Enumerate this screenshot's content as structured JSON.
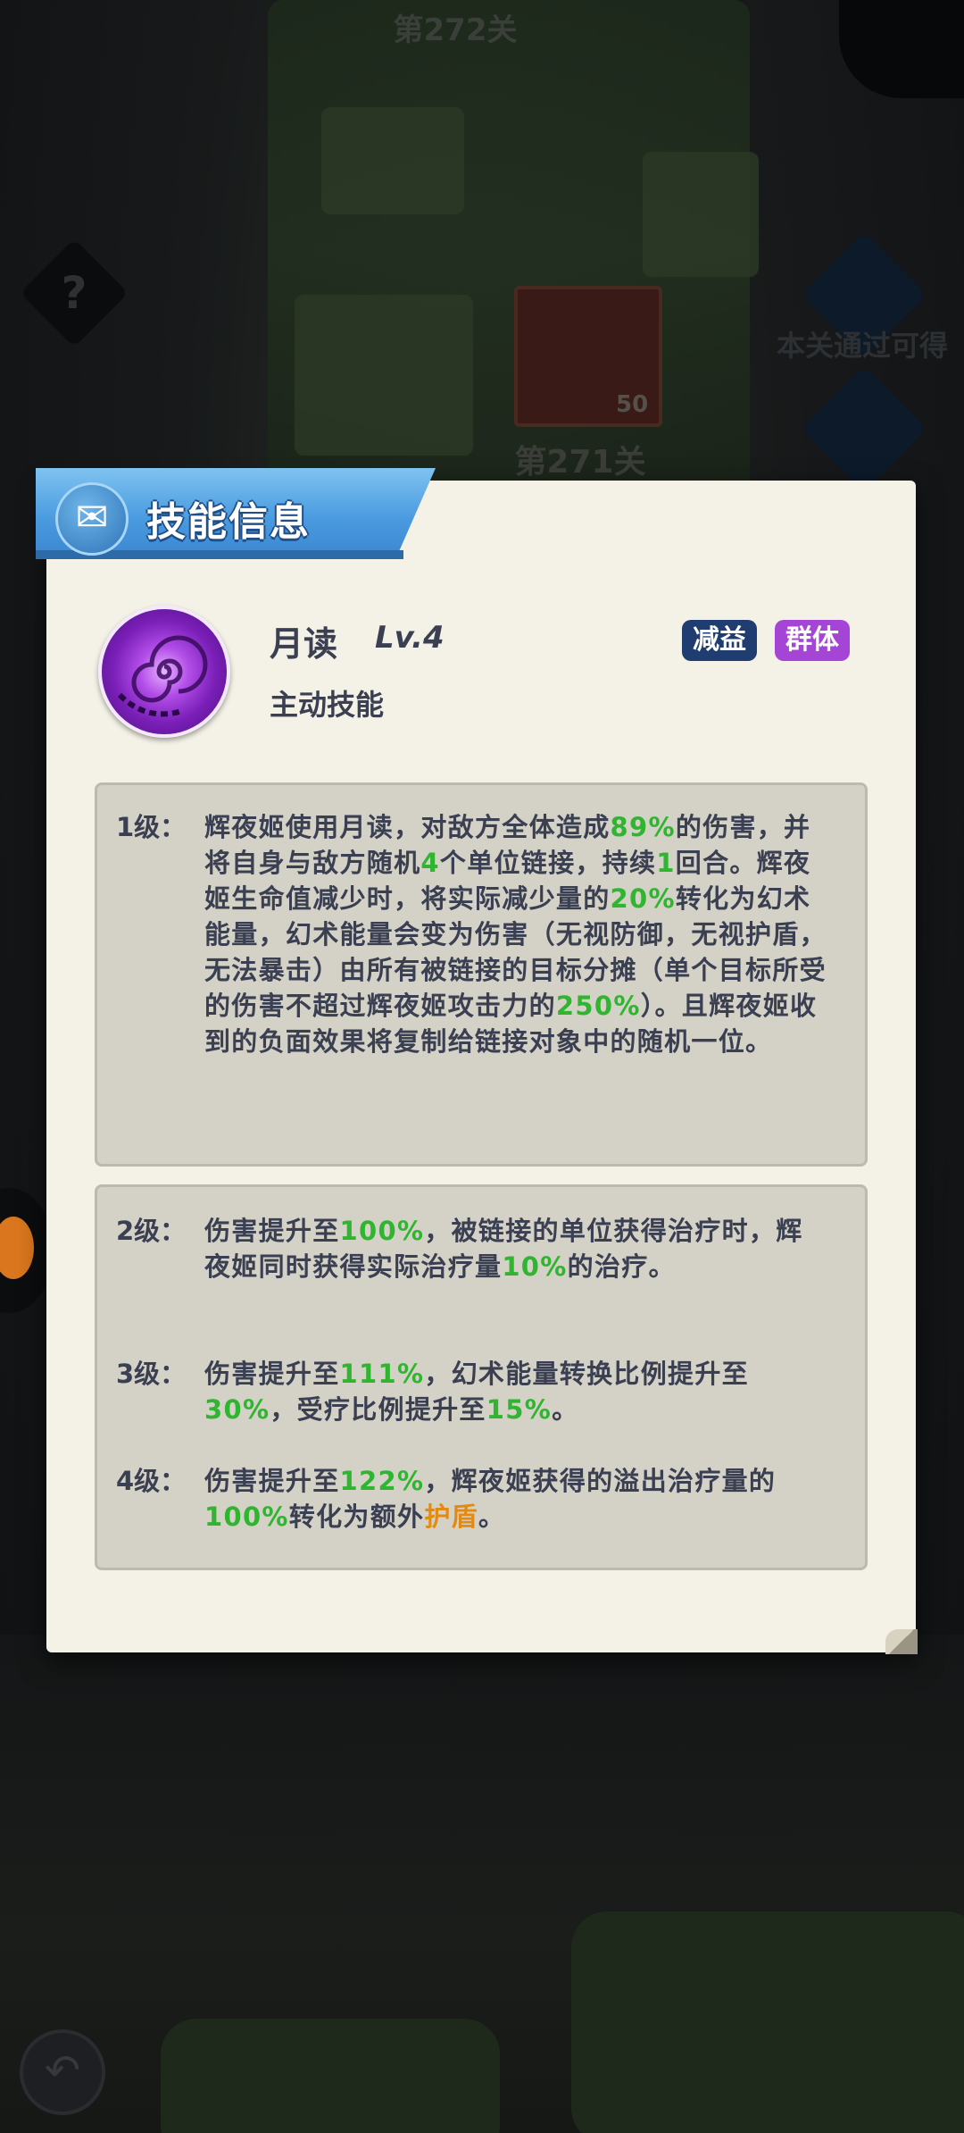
{
  "background": {
    "stage_top": "第272关",
    "stage_current": "第271关",
    "reward_count": "50",
    "reward_hint": "本关通过可得",
    "help_icon": "question-mark",
    "back_icon": "back-arrow"
  },
  "modal": {
    "title": "技能信息",
    "title_icon": "scroll-icon",
    "skill": {
      "name": "月读",
      "level": "Lv.4",
      "type": "主动技能",
      "tags": [
        "减益",
        "群体"
      ]
    },
    "levels": [
      {
        "label": "1级：",
        "parts": [
          {
            "t": "辉夜姬使用月读，对敌方全体造成"
          },
          {
            "t": "89%",
            "c": "g"
          },
          {
            "t": "的伤害，并将自身与敌方随机"
          },
          {
            "t": "4",
            "c": "g"
          },
          {
            "t": "个单位链接，持续"
          },
          {
            "t": "1",
            "c": "g"
          },
          {
            "t": "回合。辉夜姬生命值减少时，将实际减少量的"
          },
          {
            "t": "20%",
            "c": "g"
          },
          {
            "t": "转化为幻术能量，幻术能量会变为伤害（无视防御，无视护盾，无法暴击）由所有被链接的目标分摊（单个目标所受的伤害不超过辉夜姬攻击力的"
          },
          {
            "t": "250%",
            "c": "g"
          },
          {
            "t": "）。且辉夜姬收到的负面效果将复制给链接对象中的随机一位。"
          }
        ]
      },
      {
        "label": "2级：",
        "parts": [
          {
            "t": "伤害提升至"
          },
          {
            "t": "100%",
            "c": "g"
          },
          {
            "t": "，被链接的单位获得治疗时，辉夜姬同时获得实际治疗量"
          },
          {
            "t": "10%",
            "c": "g"
          },
          {
            "t": "的治疗。"
          }
        ]
      },
      {
        "label": "3级：",
        "parts": [
          {
            "t": "伤害提升至"
          },
          {
            "t": "111%",
            "c": "g"
          },
          {
            "t": "，幻术能量转换比例提升至"
          },
          {
            "t": "30%",
            "c": "g"
          },
          {
            "t": "，受疗比例提升至"
          },
          {
            "t": "15%",
            "c": "g"
          },
          {
            "t": "。"
          }
        ]
      },
      {
        "label": "4级：",
        "parts": [
          {
            "t": "伤害提升至"
          },
          {
            "t": "122%",
            "c": "g"
          },
          {
            "t": "，辉夜姬获得的溢出治疗量的"
          },
          {
            "t": "100%",
            "c": "g"
          },
          {
            "t": "转化为额外"
          },
          {
            "t": "护盾",
            "c": "o"
          },
          {
            "t": "。"
          }
        ]
      }
    ]
  }
}
